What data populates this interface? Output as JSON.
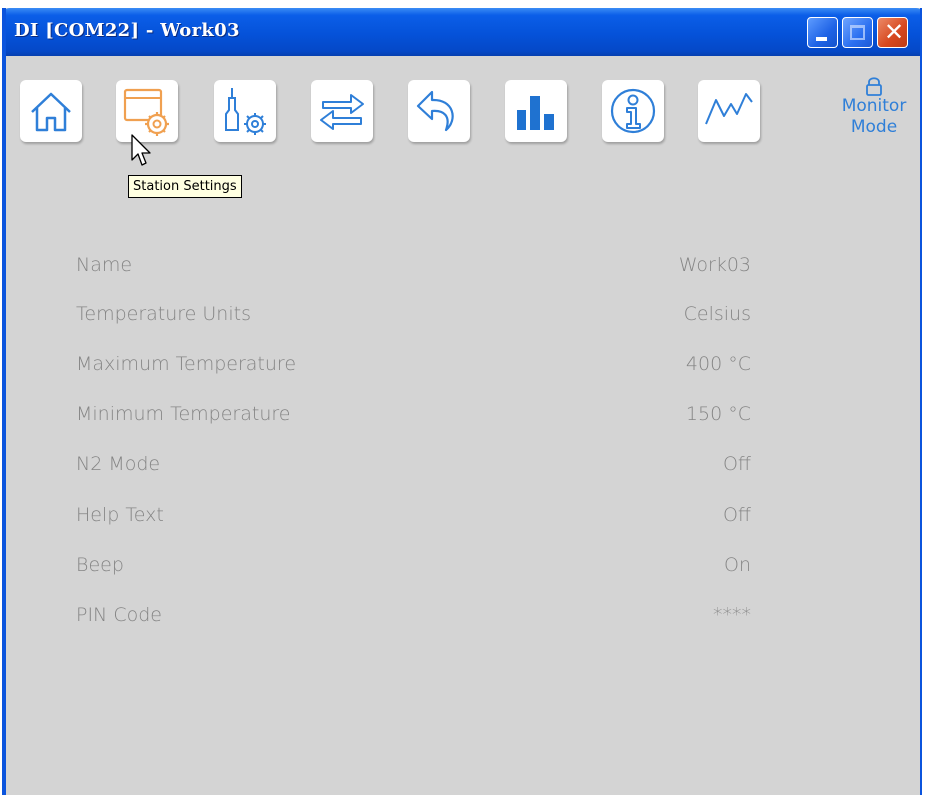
{
  "window": {
    "title": "DI [COM22] - Work03",
    "controls": {
      "minimize": "minimize",
      "maximize": "maximize",
      "close": "close"
    }
  },
  "toolbar": {
    "buttons": [
      {
        "icon": "home-icon"
      },
      {
        "icon": "station-settings-icon",
        "active": true
      },
      {
        "icon": "tool-settings-icon"
      },
      {
        "icon": "transfer-icon"
      },
      {
        "icon": "undo-icon"
      },
      {
        "icon": "statistics-icon"
      },
      {
        "icon": "info-icon"
      },
      {
        "icon": "graph-icon"
      }
    ],
    "monitor_mode": {
      "line1": "Monitor",
      "line2": "Mode",
      "icon": "lock-icon"
    }
  },
  "tooltip": {
    "text": "Station Settings"
  },
  "settings": [
    {
      "label": "Name",
      "value": "Work03"
    },
    {
      "label": "Temperature Units",
      "value": "Celsius"
    },
    {
      "label": "Maximum Temperature",
      "value": "400 °C"
    },
    {
      "label": "Minimum Temperature",
      "value": "150 °C"
    },
    {
      "label": "N2 Mode",
      "value": "Off"
    },
    {
      "label": "Help Text",
      "value": "Off"
    },
    {
      "label": "Beep",
      "value": "On"
    },
    {
      "label": "PIN Code",
      "value": "****"
    }
  ],
  "colors": {
    "titlebar": "#0552d9",
    "icon_blue": "#2f7fd8",
    "icon_active_orange": "#f0a050",
    "background": "#d4d4d4",
    "text_gray": "#858585"
  }
}
